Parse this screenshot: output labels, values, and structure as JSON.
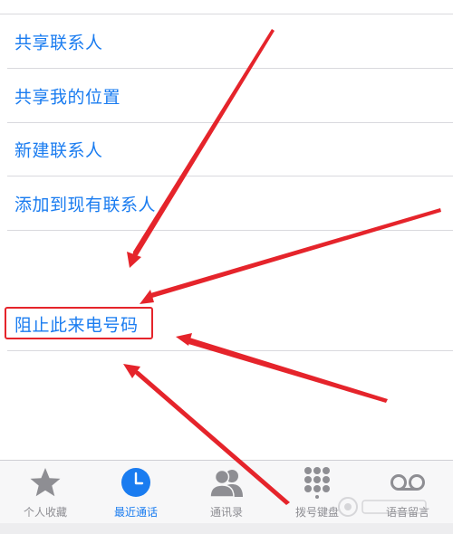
{
  "menu": {
    "items": [
      {
        "label": "共享联系人"
      },
      {
        "label": "共享我的位置"
      },
      {
        "label": "新建联系人"
      },
      {
        "label": "添加到现有联系人"
      }
    ],
    "block_label": "阻止此来电号码"
  },
  "tabs": [
    {
      "label": "个人收藏",
      "icon": "star-icon",
      "active": false
    },
    {
      "label": "最近通话",
      "icon": "clock-icon",
      "active": true
    },
    {
      "label": "通讯录",
      "icon": "contacts-icon",
      "active": false
    },
    {
      "label": "拨号键盘",
      "icon": "keypad-icon",
      "active": false
    },
    {
      "label": "语音留言",
      "icon": "voicemail-icon",
      "active": false
    }
  ],
  "colors": {
    "accent": "#1a7cf0",
    "inactive": "#8e8e93",
    "annotation": "#e5242b"
  }
}
